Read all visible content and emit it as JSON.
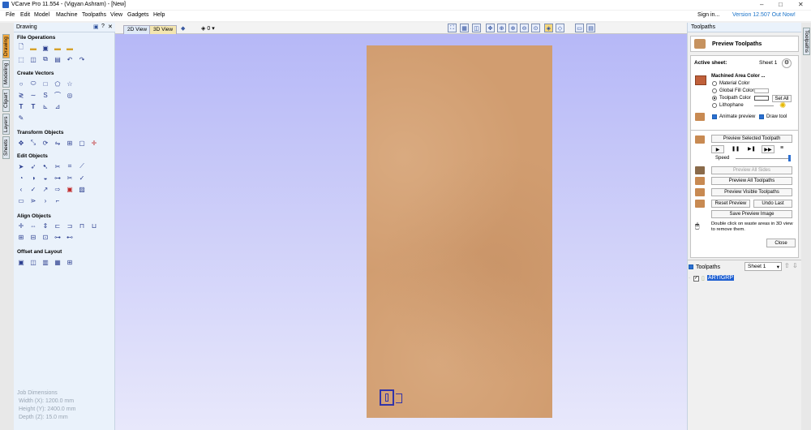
{
  "window": {
    "title": "VCarve Pro 11.554 - (Vigyan Ashram) - [New]",
    "controls": [
      "–",
      "□",
      "✕"
    ]
  },
  "menu": [
    "File",
    "Edit",
    "Model",
    "Machine",
    "Toolpaths",
    "View",
    "Gadgets",
    "Help"
  ],
  "account": {
    "signin": "Sign in...",
    "version": "Version 12.507 Out Now!"
  },
  "left_tabs": [
    "Drawing",
    "Modeling",
    "Clipart",
    "Layers",
    "Sheets"
  ],
  "left_panel": {
    "title": "Drawing",
    "sections": [
      {
        "label": "File Operations",
        "icons": [
          "new-icon",
          "open-icon",
          "save-icon",
          "folder-icon",
          "import-icon",
          "select-icon",
          "group-icon",
          "copy-icon",
          "paste-icon",
          "undo-icon",
          "redo-icon"
        ]
      },
      {
        "label": "Create Vectors",
        "icons": [
          "circle-icon",
          "ellipse-icon",
          "rectangle-icon",
          "polygon-icon",
          "star-icon",
          "line-icon",
          "curve-icon",
          "arc-icon",
          "spline-icon",
          "spiral-icon",
          "text-icon",
          "text-arc-icon",
          "dimension-icon",
          "fillet-icon",
          "pen-icon"
        ]
      },
      {
        "label": "Transform Objects",
        "icons": [
          "move-icon",
          "scale-icon",
          "rotate-icon",
          "mirror-icon",
          "align-icon",
          "distort-icon",
          "center-icon"
        ]
      },
      {
        "label": "Edit Objects",
        "icons": [
          "pointer-icon",
          "node-icon",
          "transform-icon",
          "trim-icon",
          "extend-icon",
          "knife-icon",
          "weld-icon",
          "subtract-icon",
          "intersect-icon",
          "join-icon",
          "cut-icon",
          "measure-icon",
          "smooth-icon",
          "fillet2-icon",
          "curve-fit-icon",
          "offset-icon",
          "bitmap-icon",
          "trace-icon",
          "box-icon",
          "break-icon",
          "arrow-icon",
          "corner-icon"
        ]
      },
      {
        "label": "Align Objects",
        "icons": [
          "align-center-icon",
          "align-h-icon",
          "align-v-icon",
          "align-left-icon",
          "align-right-icon",
          "align-top-icon",
          "align-bottom-icon",
          "align-mid-icon",
          "space-h-icon",
          "space-v-icon",
          "distribute-icon",
          "stack-icon"
        ]
      },
      {
        "label": "Offset and Layout",
        "icons": [
          "offset-vector-icon",
          "fillet-vector-icon",
          "nest-icon",
          "array-icon",
          "step-repeat-icon"
        ]
      }
    ],
    "job_dimensions": {
      "title": "Job Dimensions",
      "width": "Width  (X): 1200.0 mm",
      "height": "Height (Y): 2400.0 mm",
      "depth": "Depth  (Z): 15.0 mm"
    }
  },
  "view_tabs": [
    "2D View",
    "3D View"
  ],
  "layer_value": "0",
  "right_panel": {
    "header": "Toolpaths",
    "page_title": "Preview Toolpaths",
    "active_sheet_label": "Active sheet:",
    "active_sheet_value": "Sheet 1",
    "machined_area_label": "Machined Area Color ...",
    "color_options": [
      "Material Color",
      "Global Fill Color",
      "Toolpath Color",
      "Lithophane"
    ],
    "selected_color_option": "Toolpath Color",
    "set_all": "Set All",
    "animate_preview": "Animate preview",
    "draw_tool": "Draw tool",
    "preview_selected": "Preview Selected Toolpath",
    "speed_label": "Speed",
    "preview_all_sides": "Preview All Sides",
    "preview_all": "Preview All Toolpaths",
    "preview_visible": "Preview Visible Toolpaths",
    "reset_preview": "Reset Preview",
    "undo_last": "Undo Last",
    "save_image": "Save Preview Image",
    "hint": "Double click on waste areas in 3D view to remove them.",
    "close": "Close",
    "toolpaths_label": "Toolpaths",
    "sheet_select": "Sheet 1",
    "toolpath_item": "ARTIGRP"
  },
  "right_tabs": [
    "Toolpaths"
  ],
  "colors": {
    "accent": "#f4a73a",
    "viewport_top": "#b6b8f7",
    "material": "#d19d70",
    "link": "#1a73c9"
  }
}
